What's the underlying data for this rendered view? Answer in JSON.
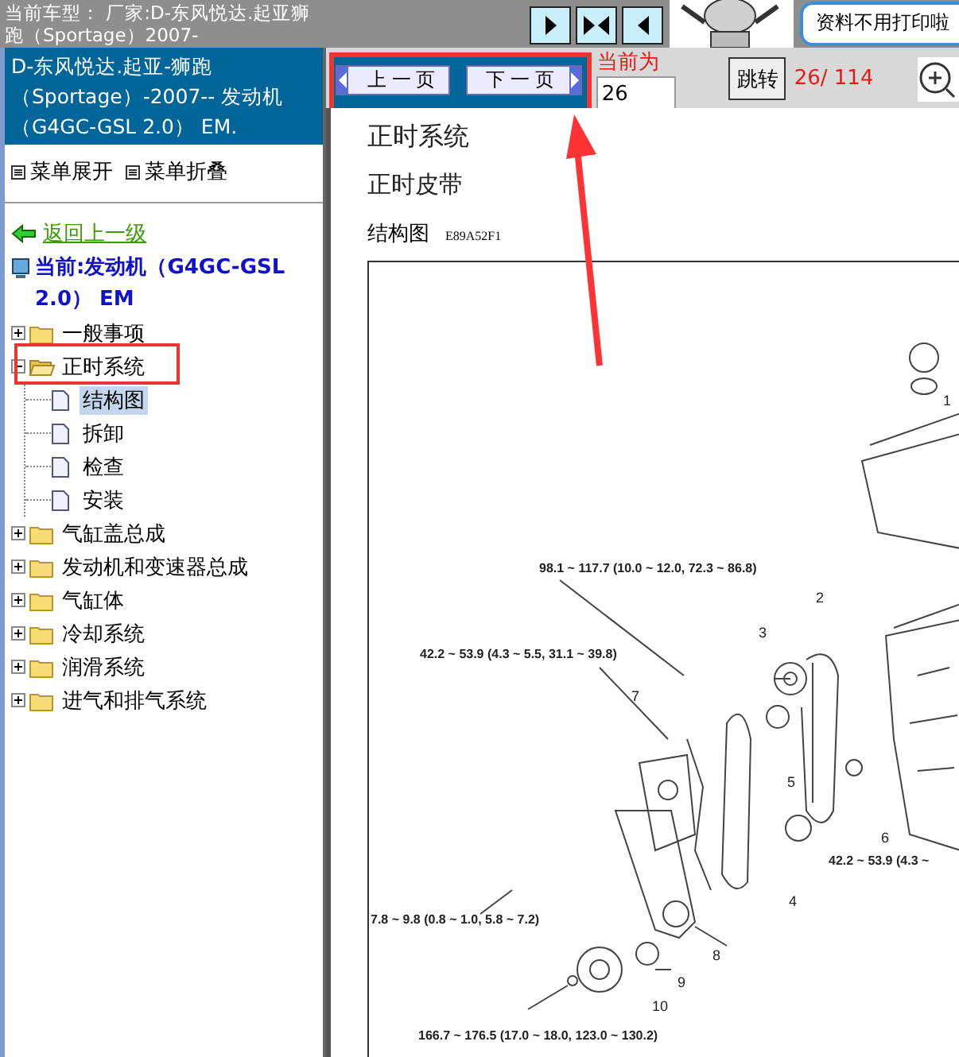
{
  "header": {
    "car_model": "当前车型：  厂家:D-东风悦达.起亚狮跑（Sportage）2007-",
    "bubble": "资料不用打印啦"
  },
  "sidebar": {
    "model_title": "D-东风悦达.起亚-狮跑（Sportage）-2007-- 发动机（G4GC-GSL 2.0） EM.",
    "menu_actions": [
      "菜单展开",
      "菜单折叠"
    ],
    "back_link": "返回上一级",
    "current": "当前:发动机（G4GC-GSL 2.0） EM",
    "tree": [
      {
        "label": "一般事项",
        "kind": "folder",
        "expanded": false,
        "marked": false
      },
      {
        "label": "正时系统",
        "kind": "folder",
        "expanded": true,
        "marked": true,
        "children": [
          {
            "label": "结构图",
            "kind": "page",
            "selected": true
          },
          {
            "label": "拆卸",
            "kind": "page",
            "selected": false
          },
          {
            "label": "检查",
            "kind": "page",
            "selected": false
          },
          {
            "label": "安装",
            "kind": "page",
            "selected": false
          }
        ]
      },
      {
        "label": "气缸盖总成",
        "kind": "folder",
        "expanded": false,
        "marked": false
      },
      {
        "label": "发动机和变速器总成",
        "kind": "folder",
        "expanded": false,
        "marked": false
      },
      {
        "label": "气缸体",
        "kind": "folder",
        "expanded": false,
        "marked": false
      },
      {
        "label": "冷却系统",
        "kind": "folder",
        "expanded": false,
        "marked": false
      },
      {
        "label": "润滑系统",
        "kind": "folder",
        "expanded": false,
        "marked": false
      },
      {
        "label": "进气和排气系统",
        "kind": "folder",
        "expanded": false,
        "marked": false
      }
    ]
  },
  "toolbar": {
    "pager": {
      "prev": "上 一 页",
      "next": "下 一 页",
      "marked": true
    },
    "page_label": "当前为",
    "page_value": "26",
    "jump": "跳转",
    "page_count": "26/ 114"
  },
  "document": {
    "heading": "正时系统",
    "subheading": "正时皮带",
    "figure_title": "结构图",
    "figure_code": "E89A52F1",
    "torque_labels": [
      "98.1 ~ 117.7 (10.0 ~ 12.0, 72.3 ~ 86.8)",
      "42.2 ~ 53.9 (4.3 ~ 5.5, 31.1 ~ 39.8)",
      "42.2 ~ 53.9 (4.3 ~",
      "7.8 ~ 9.8 (0.8 ~ 1.0, 5.8 ~ 7.2)",
      "166.7 ~ 176.5 (17.0 ~ 18.0, 123.0 ~ 130.2)"
    ],
    "part_numbers": [
      "1",
      "2",
      "3",
      "4",
      "5",
      "6",
      "7",
      "8",
      "9",
      "10"
    ]
  }
}
